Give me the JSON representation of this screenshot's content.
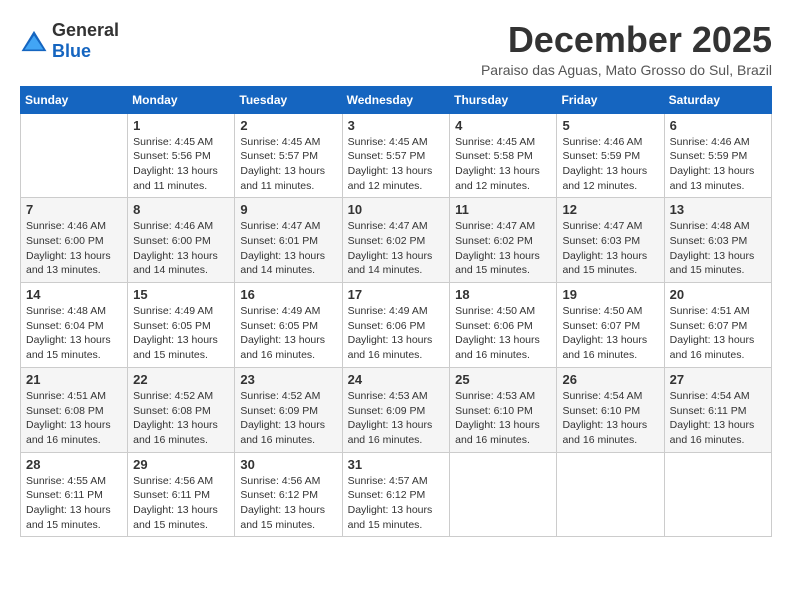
{
  "header": {
    "logo_general": "General",
    "logo_blue": "Blue",
    "month_year": "December 2025",
    "location": "Paraiso das Aguas, Mato Grosso do Sul, Brazil"
  },
  "days_of_week": [
    "Sunday",
    "Monday",
    "Tuesday",
    "Wednesday",
    "Thursday",
    "Friday",
    "Saturday"
  ],
  "weeks": [
    [
      {
        "day": "",
        "sunrise": "",
        "sunset": "",
        "daylight": ""
      },
      {
        "day": "1",
        "sunrise": "Sunrise: 4:45 AM",
        "sunset": "Sunset: 5:56 PM",
        "daylight": "Daylight: 13 hours and 11 minutes."
      },
      {
        "day": "2",
        "sunrise": "Sunrise: 4:45 AM",
        "sunset": "Sunset: 5:57 PM",
        "daylight": "Daylight: 13 hours and 11 minutes."
      },
      {
        "day": "3",
        "sunrise": "Sunrise: 4:45 AM",
        "sunset": "Sunset: 5:57 PM",
        "daylight": "Daylight: 13 hours and 12 minutes."
      },
      {
        "day": "4",
        "sunrise": "Sunrise: 4:45 AM",
        "sunset": "Sunset: 5:58 PM",
        "daylight": "Daylight: 13 hours and 12 minutes."
      },
      {
        "day": "5",
        "sunrise": "Sunrise: 4:46 AM",
        "sunset": "Sunset: 5:59 PM",
        "daylight": "Daylight: 13 hours and 12 minutes."
      },
      {
        "day": "6",
        "sunrise": "Sunrise: 4:46 AM",
        "sunset": "Sunset: 5:59 PM",
        "daylight": "Daylight: 13 hours and 13 minutes."
      }
    ],
    [
      {
        "day": "7",
        "sunrise": "Sunrise: 4:46 AM",
        "sunset": "Sunset: 6:00 PM",
        "daylight": "Daylight: 13 hours and 13 minutes."
      },
      {
        "day": "8",
        "sunrise": "Sunrise: 4:46 AM",
        "sunset": "Sunset: 6:00 PM",
        "daylight": "Daylight: 13 hours and 14 minutes."
      },
      {
        "day": "9",
        "sunrise": "Sunrise: 4:47 AM",
        "sunset": "Sunset: 6:01 PM",
        "daylight": "Daylight: 13 hours and 14 minutes."
      },
      {
        "day": "10",
        "sunrise": "Sunrise: 4:47 AM",
        "sunset": "Sunset: 6:02 PM",
        "daylight": "Daylight: 13 hours and 14 minutes."
      },
      {
        "day": "11",
        "sunrise": "Sunrise: 4:47 AM",
        "sunset": "Sunset: 6:02 PM",
        "daylight": "Daylight: 13 hours and 15 minutes."
      },
      {
        "day": "12",
        "sunrise": "Sunrise: 4:47 AM",
        "sunset": "Sunset: 6:03 PM",
        "daylight": "Daylight: 13 hours and 15 minutes."
      },
      {
        "day": "13",
        "sunrise": "Sunrise: 4:48 AM",
        "sunset": "Sunset: 6:03 PM",
        "daylight": "Daylight: 13 hours and 15 minutes."
      }
    ],
    [
      {
        "day": "14",
        "sunrise": "Sunrise: 4:48 AM",
        "sunset": "Sunset: 6:04 PM",
        "daylight": "Daylight: 13 hours and 15 minutes."
      },
      {
        "day": "15",
        "sunrise": "Sunrise: 4:49 AM",
        "sunset": "Sunset: 6:05 PM",
        "daylight": "Daylight: 13 hours and 15 minutes."
      },
      {
        "day": "16",
        "sunrise": "Sunrise: 4:49 AM",
        "sunset": "Sunset: 6:05 PM",
        "daylight": "Daylight: 13 hours and 16 minutes."
      },
      {
        "day": "17",
        "sunrise": "Sunrise: 4:49 AM",
        "sunset": "Sunset: 6:06 PM",
        "daylight": "Daylight: 13 hours and 16 minutes."
      },
      {
        "day": "18",
        "sunrise": "Sunrise: 4:50 AM",
        "sunset": "Sunset: 6:06 PM",
        "daylight": "Daylight: 13 hours and 16 minutes."
      },
      {
        "day": "19",
        "sunrise": "Sunrise: 4:50 AM",
        "sunset": "Sunset: 6:07 PM",
        "daylight": "Daylight: 13 hours and 16 minutes."
      },
      {
        "day": "20",
        "sunrise": "Sunrise: 4:51 AM",
        "sunset": "Sunset: 6:07 PM",
        "daylight": "Daylight: 13 hours and 16 minutes."
      }
    ],
    [
      {
        "day": "21",
        "sunrise": "Sunrise: 4:51 AM",
        "sunset": "Sunset: 6:08 PM",
        "daylight": "Daylight: 13 hours and 16 minutes."
      },
      {
        "day": "22",
        "sunrise": "Sunrise: 4:52 AM",
        "sunset": "Sunset: 6:08 PM",
        "daylight": "Daylight: 13 hours and 16 minutes."
      },
      {
        "day": "23",
        "sunrise": "Sunrise: 4:52 AM",
        "sunset": "Sunset: 6:09 PM",
        "daylight": "Daylight: 13 hours and 16 minutes."
      },
      {
        "day": "24",
        "sunrise": "Sunrise: 4:53 AM",
        "sunset": "Sunset: 6:09 PM",
        "daylight": "Daylight: 13 hours and 16 minutes."
      },
      {
        "day": "25",
        "sunrise": "Sunrise: 4:53 AM",
        "sunset": "Sunset: 6:10 PM",
        "daylight": "Daylight: 13 hours and 16 minutes."
      },
      {
        "day": "26",
        "sunrise": "Sunrise: 4:54 AM",
        "sunset": "Sunset: 6:10 PM",
        "daylight": "Daylight: 13 hours and 16 minutes."
      },
      {
        "day": "27",
        "sunrise": "Sunrise: 4:54 AM",
        "sunset": "Sunset: 6:11 PM",
        "daylight": "Daylight: 13 hours and 16 minutes."
      }
    ],
    [
      {
        "day": "28",
        "sunrise": "Sunrise: 4:55 AM",
        "sunset": "Sunset: 6:11 PM",
        "daylight": "Daylight: 13 hours and 15 minutes."
      },
      {
        "day": "29",
        "sunrise": "Sunrise: 4:56 AM",
        "sunset": "Sunset: 6:11 PM",
        "daylight": "Daylight: 13 hours and 15 minutes."
      },
      {
        "day": "30",
        "sunrise": "Sunrise: 4:56 AM",
        "sunset": "Sunset: 6:12 PM",
        "daylight": "Daylight: 13 hours and 15 minutes."
      },
      {
        "day": "31",
        "sunrise": "Sunrise: 4:57 AM",
        "sunset": "Sunset: 6:12 PM",
        "daylight": "Daylight: 13 hours and 15 minutes."
      },
      {
        "day": "",
        "sunrise": "",
        "sunset": "",
        "daylight": ""
      },
      {
        "day": "",
        "sunrise": "",
        "sunset": "",
        "daylight": ""
      },
      {
        "day": "",
        "sunrise": "",
        "sunset": "",
        "daylight": ""
      }
    ]
  ]
}
